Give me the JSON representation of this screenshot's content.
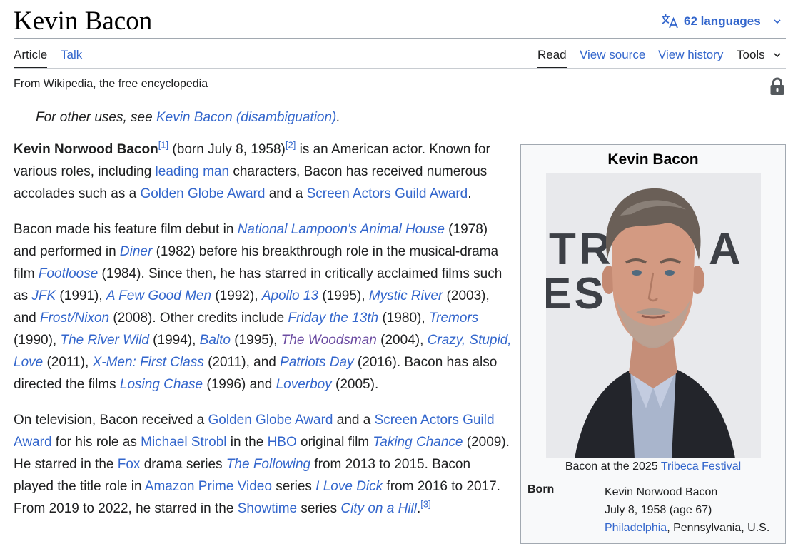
{
  "header": {
    "title": "Kevin Bacon",
    "languages_label": "62 languages",
    "language_icon": "translate-icon",
    "tabs_left": [
      "Article",
      "Talk"
    ],
    "tabs_right": [
      "Read",
      "View source",
      "View history"
    ],
    "tools_label": "Tools"
  },
  "tagline": "From Wikipedia, the free encyclopedia",
  "lock_icon": "lock-icon",
  "hatnote": {
    "prefix": "For other uses, see ",
    "link": "Kevin Bacon (disambiguation)",
    "suffix": "."
  },
  "p1": {
    "name": "Kevin Norwood Bacon",
    "ref1": "[1]",
    "t1": " (born July 8, 1958)",
    "ref2": "[2]",
    "t2": " is an American actor. Known for various roles, including ",
    "l1": "leading man",
    "t3": " characters, Bacon has received numerous accolades such as a ",
    "l2": "Golden Globe Award",
    "t4": " and a ",
    "l3": "Screen Actors Guild Award",
    "t5": "."
  },
  "p2": {
    "t0": "Bacon made his feature film debut in ",
    "f1": "National Lampoon's Animal House",
    "t1": " (1978) and performed in ",
    "f2": "Diner",
    "t2": " (1982) before his breakthrough role in the musical-drama film ",
    "f3": "Footloose",
    "t3": " (1984). Since then, he has starred in critically acclaimed films such as ",
    "f4": "JFK",
    "t4": " (1991), ",
    "f5": "A Few Good Men",
    "t5": " (1992), ",
    "f6": "Apollo 13",
    "t6": " (1995), ",
    "f7": "Mystic River",
    "t7": " (2003), and ",
    "f8": "Frost/Nixon",
    "t8": " (2008). Other credits include ",
    "f9": "Friday the 13th",
    "t9": " (1980), ",
    "f10": "Tremors",
    "t10": " (1990), ",
    "f11": "The River Wild",
    "t11": " (1994), ",
    "f12": "Balto",
    "t12": " (1995), ",
    "f13": "The Woodsman",
    "t13": " (2004), ",
    "f14": "Crazy, Stupid, Love",
    "t14": " (2011), ",
    "f15": "X-Men: First Class",
    "t15": " (2011), and ",
    "f16": "Patriots Day",
    "t16": " (2016). Bacon has also directed the films ",
    "f17": "Losing Chase",
    "t17": " (1996) and ",
    "f18": "Loverboy",
    "t18": " (2005)."
  },
  "p3": {
    "t0": "On television, Bacon received a ",
    "l1": "Golden Globe Award",
    "t1": " and a ",
    "l2": "Screen Actors Guild Award",
    "t2": " for his role as ",
    "l3": "Michael Strobl",
    "t3": " in the ",
    "l4": "HBO",
    "t4": " original film ",
    "l5": "Taking Chance",
    "t5": " (2009). He starred in the ",
    "l6": "Fox",
    "t6": " drama series ",
    "l7": "The Following",
    "t7": " from 2013 to 2015. Bacon played the title role in ",
    "l8": "Amazon Prime Video",
    "t8": " series ",
    "l9": "I Love Dick",
    "t9": " from 2016 to 2017. From 2019 to 2022, he starred in the ",
    "l10": "Showtime",
    "t10": " series ",
    "l11": "City on a Hill",
    "t11": ".",
    "ref3": "[3]"
  },
  "infobox": {
    "title": "Kevin Bacon",
    "backdrop_text": [
      "TRI",
      "A",
      "EST"
    ],
    "caption_prefix": "Bacon at the 2025 ",
    "caption_link": "Tribeca Festival",
    "born_label": "Born",
    "born_name": "Kevin Norwood Bacon",
    "born_date": "July 8, 1958 (age 67)",
    "born_place_link": "Philadelphia",
    "born_place_rest": ", Pennsylvania, U.S."
  }
}
